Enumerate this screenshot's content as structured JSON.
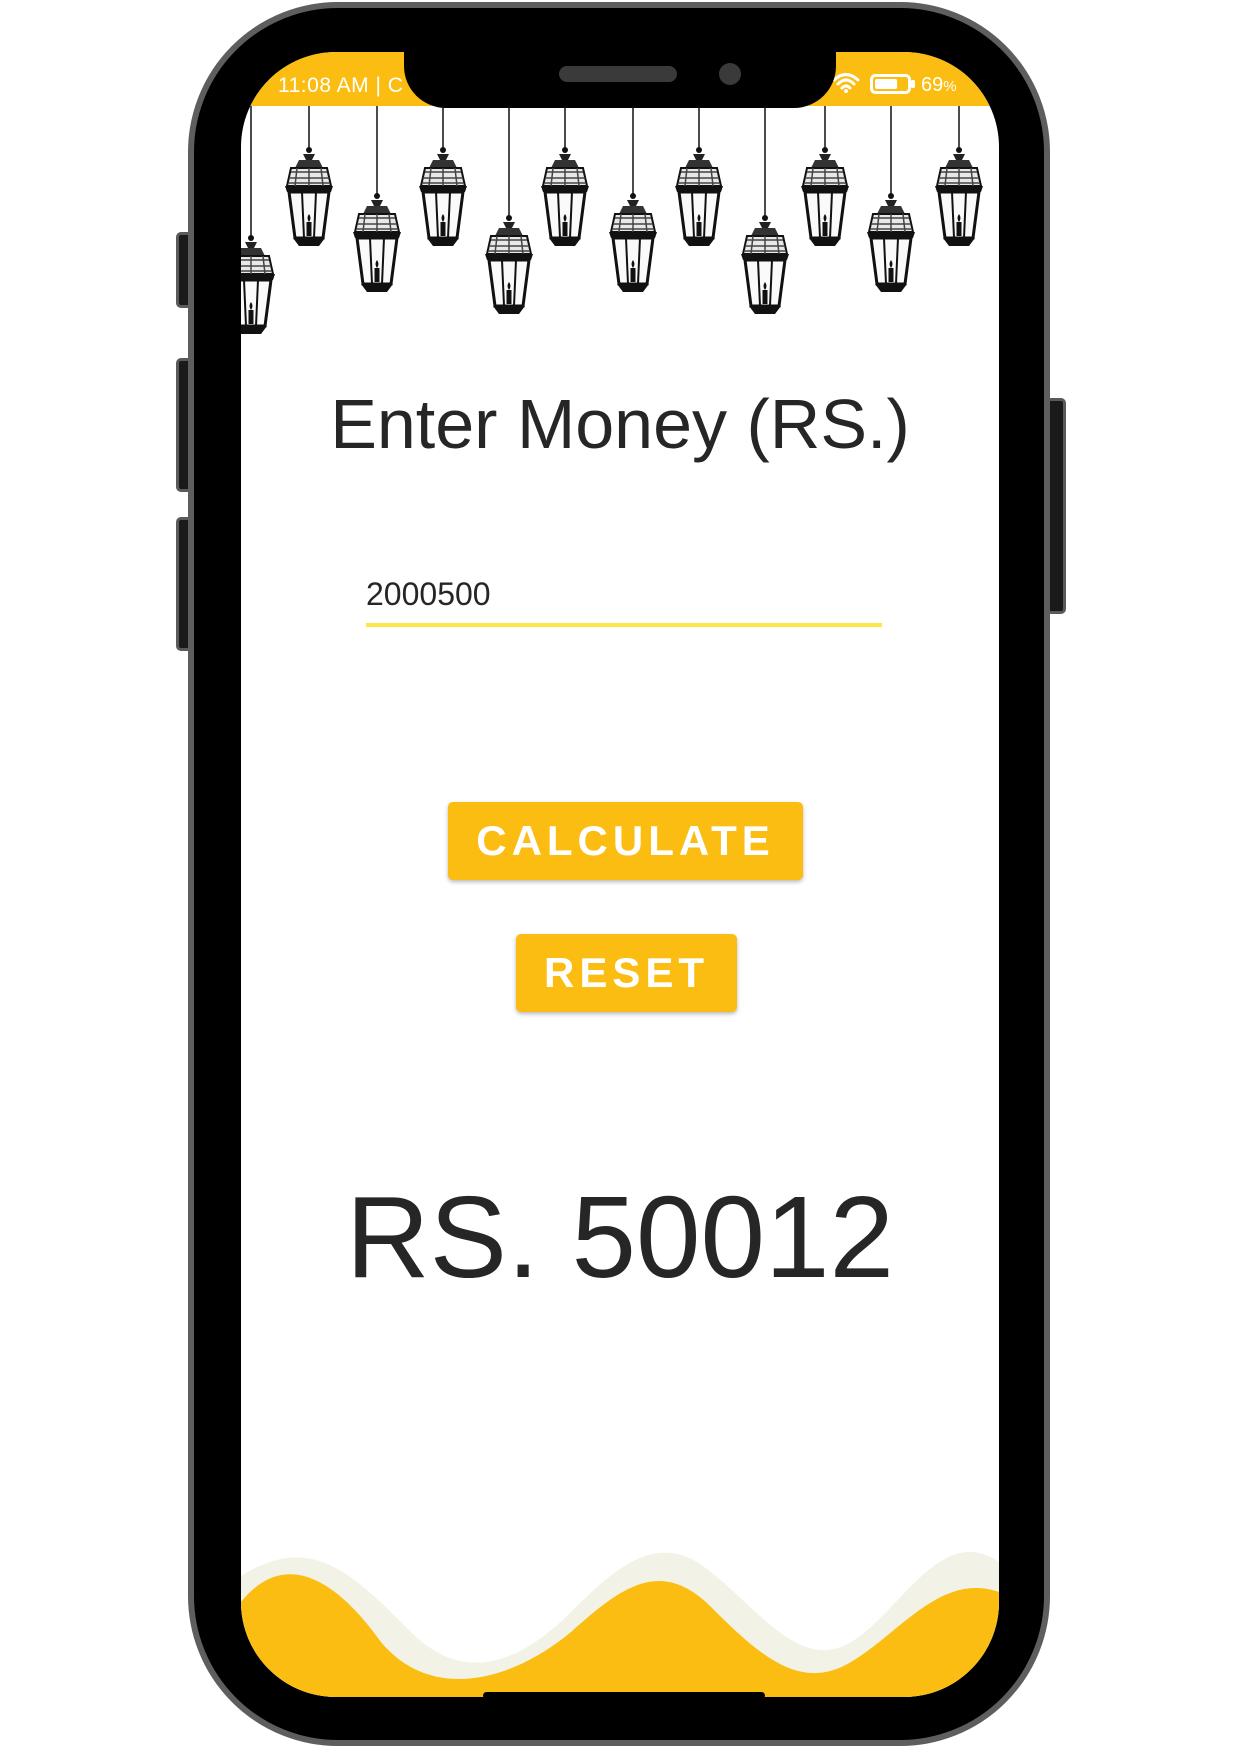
{
  "status_bar": {
    "time": "11:08 AM | C",
    "battery_percent": "69",
    "battery_unit": "%",
    "battery_level": 0.69,
    "background_color": "#fbbd11"
  },
  "form": {
    "heading": "Enter Money (RS.)",
    "input_value": "2000500",
    "input_underline_color": "#fce64a"
  },
  "buttons": {
    "calculate_label": "CALCULATE",
    "reset_label": "RESET",
    "color": "#fbbd11"
  },
  "result": {
    "text": "RS. 50012"
  },
  "decor": {
    "top": "hanging-lanterns-illustration",
    "bottom": "yellow-wave-pattern",
    "wave_color": "#fbbd11",
    "wave_trim_color": "#f2f3e6"
  }
}
